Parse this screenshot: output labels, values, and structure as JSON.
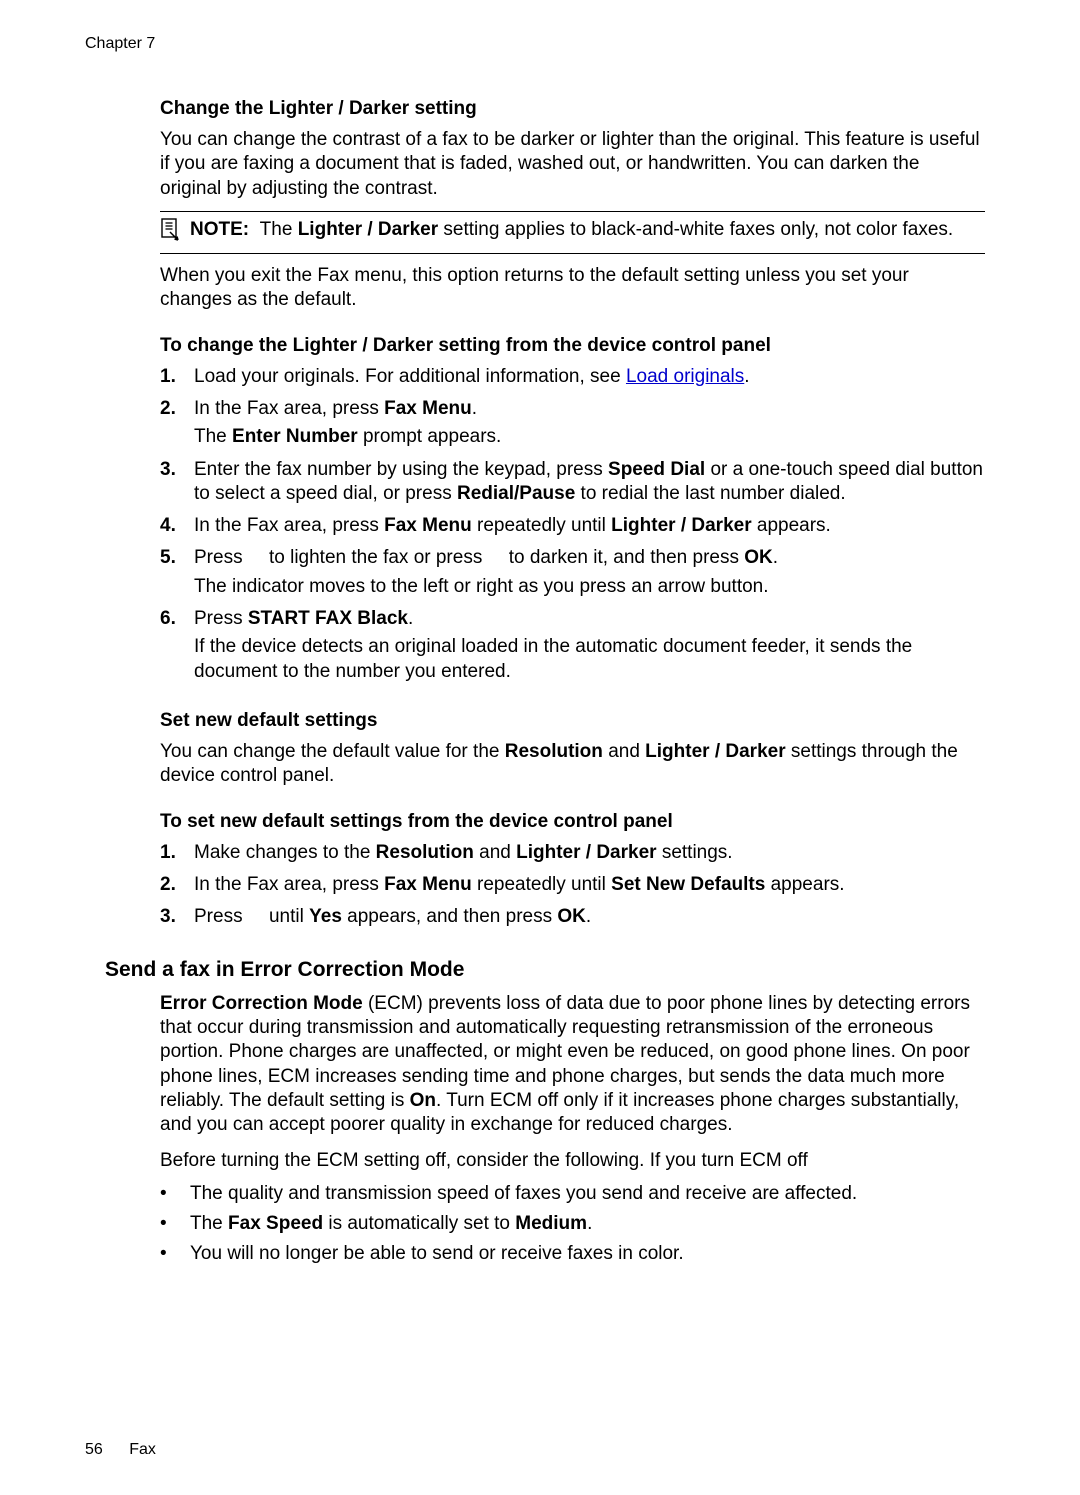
{
  "header": {
    "chapter": "Chapter 7"
  },
  "section_lighterdarker": {
    "title": "Change the Lighter / Darker setting",
    "intro": "You can change the contrast of a fax to be darker or lighter than the original. This feature is useful if you are faxing a document that is faded, washed out, or handwritten. You can darken the original by adjusting the contrast."
  },
  "note": {
    "label": "NOTE:",
    "pre": "The",
    "bold1": "Lighter / Darker",
    "post": "setting applies to black-and-white faxes only, not color faxes."
  },
  "after_note": "When you exit the Fax menu, this option returns to the default setting unless you set your changes as the default.",
  "procedure1": {
    "title": "To change the Lighter / Darker setting from the device control panel",
    "steps": [
      {
        "num": "1.",
        "pre": "Load your originals. For additional information, see",
        "link": "Load originals",
        "post": "."
      },
      {
        "num": "2.",
        "line1_pre": "In the Fax area, press",
        "line1_bold": "Fax Menu",
        "line1_post": ".",
        "line2_pre": "The",
        "line2_bold": "Enter Number",
        "line2_post": "prompt appears."
      },
      {
        "num": "3.",
        "pre": "Enter the fax number by using the keypad, press",
        "bold1": "Speed Dial",
        "mid1": "or a one-touch speed dial button to select a speed dial, or press",
        "bold2": "Redial/Pause",
        "post": "to redial the last number dialed."
      },
      {
        "num": "4.",
        "pre": "In the Fax area, press",
        "bold1": "Fax Menu",
        "mid1": "repeatedly until",
        "bold2": "Lighter / Darker",
        "post": "appears."
      },
      {
        "num": "5.",
        "line1_pre": "Press",
        "line1_mid1": "to lighten the fax or press",
        "line1_mid2": "to darken it, and then press",
        "line1_bold": "OK",
        "line1_post": ".",
        "line2": "The indicator moves to the left or right as you press an arrow button."
      },
      {
        "num": "6.",
        "line1_pre": "Press",
        "line1_bold": "START FAX Black",
        "line1_post": ".",
        "line2": "If the device detects an original loaded in the automatic document feeder, it sends the document to the number you entered."
      }
    ]
  },
  "section_defaults": {
    "title": "Set new default settings",
    "intro_pre": "You can change the default value for the",
    "intro_bold1": "Resolution",
    "intro_mid": "and",
    "intro_bold2": "Lighter / Darker",
    "intro_post": "settings through the device control panel."
  },
  "procedure2": {
    "title": "To set new default settings from the device control panel",
    "steps": [
      {
        "num": "1.",
        "pre": "Make changes to the",
        "bold1": "Resolution",
        "mid": "and",
        "bold2": "Lighter / Darker",
        "post": "settings."
      },
      {
        "num": "2.",
        "pre": "In the Fax area, press",
        "bold1": "Fax Menu",
        "mid": "repeatedly until",
        "bold2": "Set New Defaults",
        "post": "appears."
      },
      {
        "num": "3.",
        "pre": "Press",
        "mid": "until",
        "bold1": "Yes",
        "mid2": "appears, and then press",
        "bold2": "OK",
        "post": "."
      }
    ]
  },
  "section_ecm": {
    "title": "Send a fax in Error Correction Mode",
    "para_bold_lead": "Error Correction Mode",
    "para_after_lead": "(ECM) prevents loss of data due to poor phone lines by detecting errors that occur during transmission and automatically requesting retransmission of the erroneous portion. Phone charges are unaffected, or might even be reduced, on good phone lines. On poor phone lines, ECM increases sending time and phone charges, but sends the data much more reliably. The default setting is",
    "para_bold_on": "On",
    "para_after_on": ". Turn ECM off only if it increases phone charges substantially, and you can accept poorer quality in exchange for reduced charges.",
    "para2": "Before turning the ECM setting off, consider the following. If you turn ECM off",
    "bullets": [
      {
        "text": "The quality and transmission speed of faxes you send and receive are affected."
      },
      {
        "pre": "The",
        "bold1": "Fax Speed",
        "mid": "is automatically set to",
        "bold2": "Medium",
        "post": "."
      },
      {
        "text": "You will no longer be able to send or receive faxes in color."
      }
    ]
  },
  "footer": {
    "page_number": "56",
    "section_name": "Fax"
  }
}
